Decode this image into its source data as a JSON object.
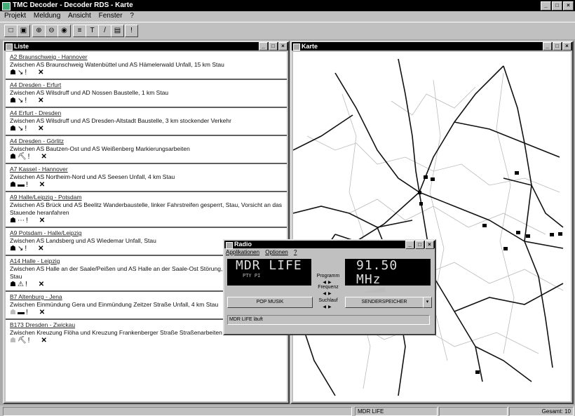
{
  "app": {
    "title": "TMC Decoder - Decoder RDS - Karte"
  },
  "menu": [
    "Projekt",
    "Meldung",
    "Ansicht",
    "Fenster",
    "?"
  ],
  "toolbar_icons": [
    "new-icon",
    "close-icon",
    "zoom-in-icon",
    "zoom-out-icon",
    "globe-icon",
    "list-icon",
    "text-icon",
    "filter-icon",
    "tmc-icon",
    "info-icon"
  ],
  "list_window": {
    "title": "Liste"
  },
  "map_window": {
    "title": "Karte"
  },
  "entries": [
    {
      "road": "A2 Braunschweig - Hannover",
      "desc": "Zwischen AS Braunschweig Watenbüttel und AS Hämelerwald Unfall, 15 km Stau"
    },
    {
      "road": "A4 Dresden - Erfurt",
      "desc": "Zwischen AS Wilsdruff und AD Nossen Baustelle, 1 km Stau"
    },
    {
      "road": "A4 Erfurt - Dresden",
      "desc": "Zwischen AS Wilsdruff und AS Dresden-Altstadt Baustelle, 3 km stockender Verkehr"
    },
    {
      "road": "A4 Dresden - Görlitz",
      "desc": "Zwischen AS Bautzen-Ost und AS Weißenberg Markierungsarbeiten"
    },
    {
      "road": "A7 Kassel - Hannover",
      "desc": "Zwischen AS Northeim-Nord und AS Seesen Unfall, 4 km Stau"
    },
    {
      "road": "A9 Halle/Leipzig - Potsdam",
      "desc": "Zwischen AS Brück und AS Beelitz Wanderbaustelle, linker Fahrstreifen gesperrt, Stau, Vorsicht an das Stauende heranfahren"
    },
    {
      "road": "A9 Potsdam - Halle/Leipzig",
      "desc": "Zwischen AS Landsberg und AS Wiedemar Unfall, Stau"
    },
    {
      "road": "A14 Halle - Leipzig",
      "desc": "Zwischen AS Halle an der Saale/Peißen und AS Halle an der Saale-Ost Störung, Bergungsarbeiten, Stau"
    },
    {
      "road": "B7 Altenburg - Jena",
      "desc": "Zwischen Einmündung Gera und Einmündung Zeitzer Straße Unfall, 4 km Stau"
    },
    {
      "road": "B173 Dresden - Zwickau",
      "desc": "Zwischen Kreuzung Flöha und Kreuzung Frankenberger Straße Straßenarbeiten"
    }
  ],
  "radio": {
    "title": "Radio",
    "menu": [
      "Applikationen",
      "Optionen",
      "?"
    ],
    "station": "MDR LIFE",
    "pi_code": "PTY  PI",
    "frequency": "91.50 MHz",
    "labels": {
      "program": "Programm",
      "frequency": "Frequenz",
      "search": "Suchlauf"
    },
    "pty_button": "POP MUSIK",
    "memory_button": "SENDERSPEICHER",
    "status": "MDR LIFE läuft"
  },
  "status": {
    "station": "MDR LIFE",
    "count": "Gesamt: 10"
  }
}
